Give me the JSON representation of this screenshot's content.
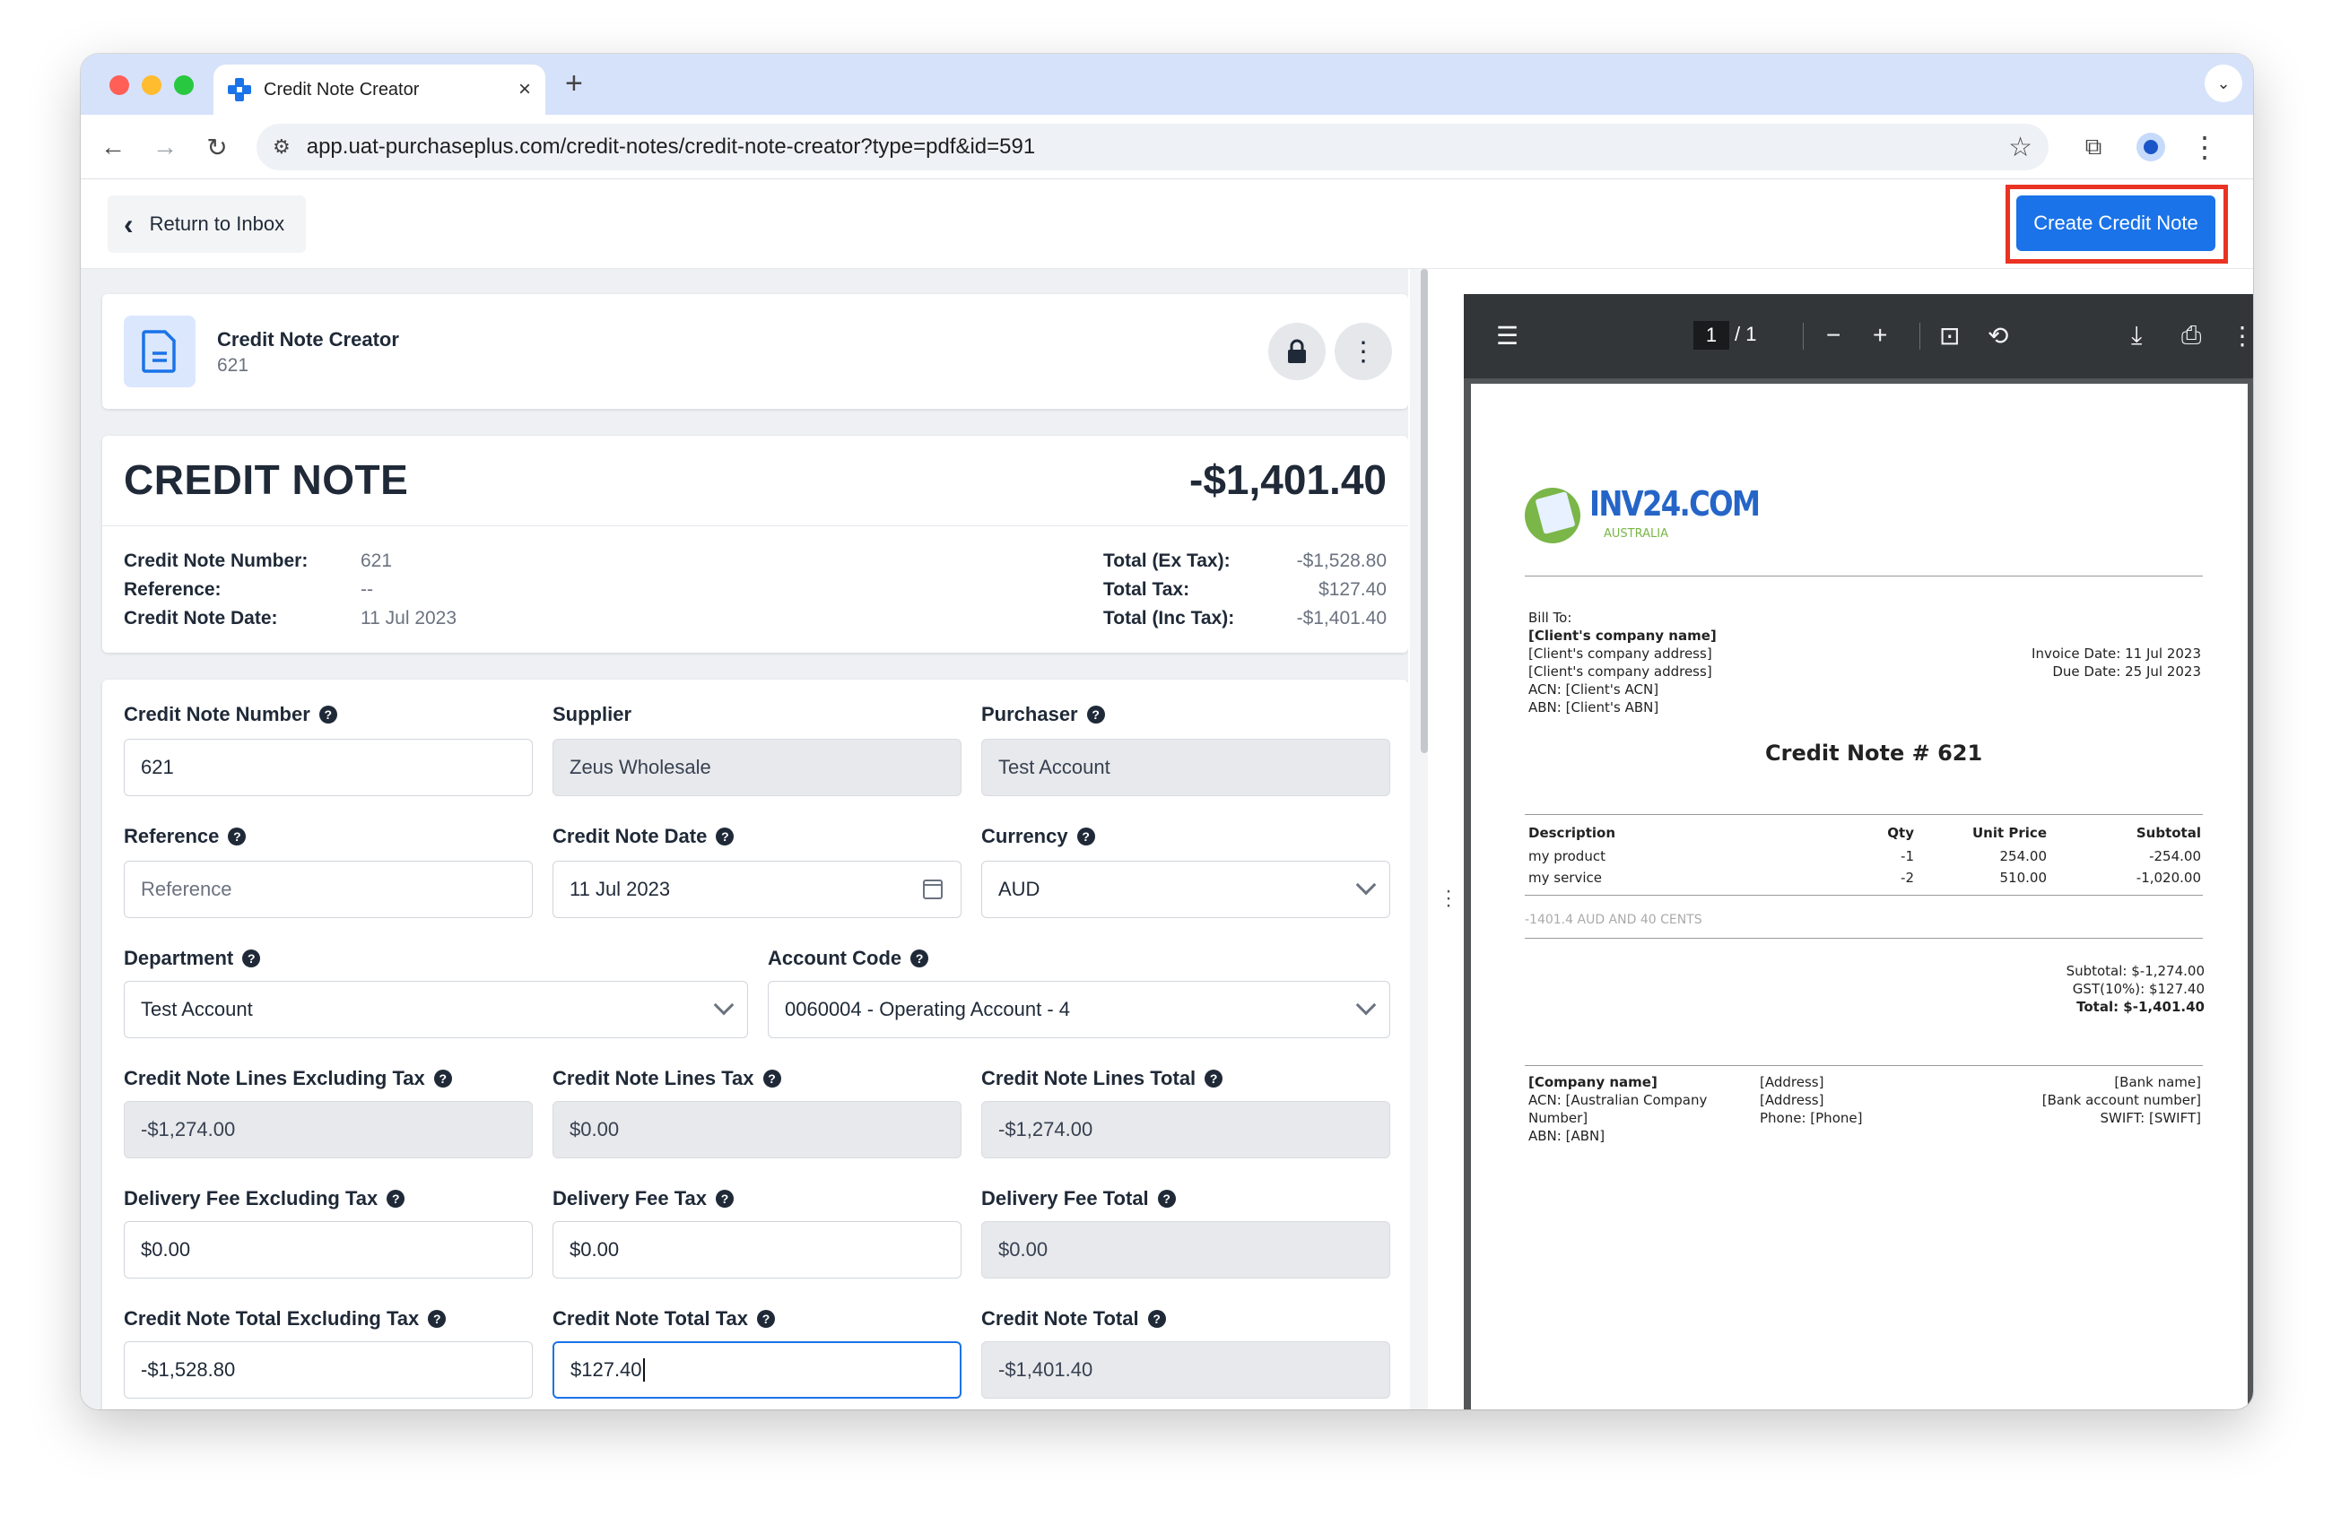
{
  "browser": {
    "tab_title": "Credit Note Creator",
    "url": "app.uat-purchaseplus.com/credit-notes/credit-note-creator?type=pdf&id=591"
  },
  "appbar": {
    "return_label": "Return to Inbox",
    "create_label": "Create Credit Note"
  },
  "header_card": {
    "title": "Credit Note Creator",
    "subtitle": "621"
  },
  "summary": {
    "heading": "CREDIT NOTE",
    "total": "-$1,401.40",
    "left": [
      {
        "label": "Credit Note Number:",
        "value": "621"
      },
      {
        "label": "Reference:",
        "value": "--"
      },
      {
        "label": "Credit Note Date:",
        "value": "11 Jul 2023"
      }
    ],
    "right": [
      {
        "label": "Total (Ex Tax):",
        "value": "-$1,528.80"
      },
      {
        "label": "Total Tax:",
        "value": "$127.40"
      },
      {
        "label": "Total (Inc Tax):",
        "value": "-$1,401.40"
      }
    ]
  },
  "form": {
    "credit_note_number": {
      "label": "Credit Note Number",
      "value": "621"
    },
    "supplier": {
      "label": "Supplier",
      "value": "Zeus Wholesale"
    },
    "purchaser": {
      "label": "Purchaser",
      "value": "Test Account"
    },
    "reference": {
      "label": "Reference",
      "placeholder": "Reference"
    },
    "credit_note_date": {
      "label": "Credit Note Date",
      "value": "11 Jul 2023"
    },
    "currency": {
      "label": "Currency",
      "value": "AUD"
    },
    "department": {
      "label": "Department",
      "value": "Test Account"
    },
    "account_code": {
      "label": "Account Code",
      "value": "0060004 - Operating Account - 4"
    },
    "lines_ex_tax": {
      "label": "Credit Note Lines Excluding Tax",
      "value": "-$1,274.00"
    },
    "lines_tax": {
      "label": "Credit Note Lines Tax",
      "value": "$0.00"
    },
    "lines_total": {
      "label": "Credit Note Lines Total",
      "value": "-$1,274.00"
    },
    "delivery_ex_tax": {
      "label": "Delivery Fee Excluding Tax",
      "value": "$0.00"
    },
    "delivery_tax": {
      "label": "Delivery Fee Tax",
      "value": "$0.00"
    },
    "delivery_total": {
      "label": "Delivery Fee Total",
      "value": "$0.00"
    },
    "total_ex_tax": {
      "label": "Credit Note Total Excluding Tax",
      "value": "-$1,528.80"
    },
    "total_tax": {
      "label": "Credit Note Total Tax",
      "value": "$127.40"
    },
    "total": {
      "label": "Credit Note Total",
      "value": "-$1,401.40"
    }
  },
  "pdf_viewer": {
    "page_current": "1",
    "page_total": "/  1"
  },
  "pdf_doc": {
    "logo_text": "INV24.COM",
    "logo_sub": "AUSTRALIA",
    "bill_to_label": "Bill To:",
    "client_name": "[Client's company name]",
    "client_addr1": "[Client's company address]",
    "client_addr2": "[Client's company address]",
    "client_acn": "ACN: [Client's ACN]",
    "client_abn": "ABN: [Client's ABN]",
    "invoice_date": "Invoice Date: 11 Jul 2023",
    "due_date": "Due Date: 25 Jul 2023",
    "doc_title": "Credit Note # 621",
    "columns": [
      "Description",
      "Qty",
      "Unit Price",
      "Subtotal"
    ],
    "lines": [
      {
        "desc": "my product",
        "qty": "-1",
        "price": "254.00",
        "subtotal": "-254.00"
      },
      {
        "desc": "my service",
        "qty": "-2",
        "price": "510.00",
        "subtotal": "-1,020.00"
      }
    ],
    "amount_words": "-1401.4 AUD AND 40 CENTS",
    "subtotal": "Subtotal: $-1,274.00",
    "gst": "GST(10%): $127.40",
    "total": "Total: $-1,401.40",
    "footer_company": "[Company name]",
    "footer_acn": "ACN: [Australian Company",
    "footer_acn2": "Number]",
    "footer_abn": "ABN: [ABN]",
    "footer_addr1": "[Address]",
    "footer_addr2": "[Address]",
    "footer_phone": "Phone: [Phone]",
    "footer_bank": "[Bank name]",
    "footer_account": "[Bank account number]",
    "footer_swift": "SWIFT: [SWIFT]"
  },
  "colors": {
    "primary": "#1a73e8",
    "highlight": "#ea3323",
    "pdf_toolbar": "#323639"
  }
}
